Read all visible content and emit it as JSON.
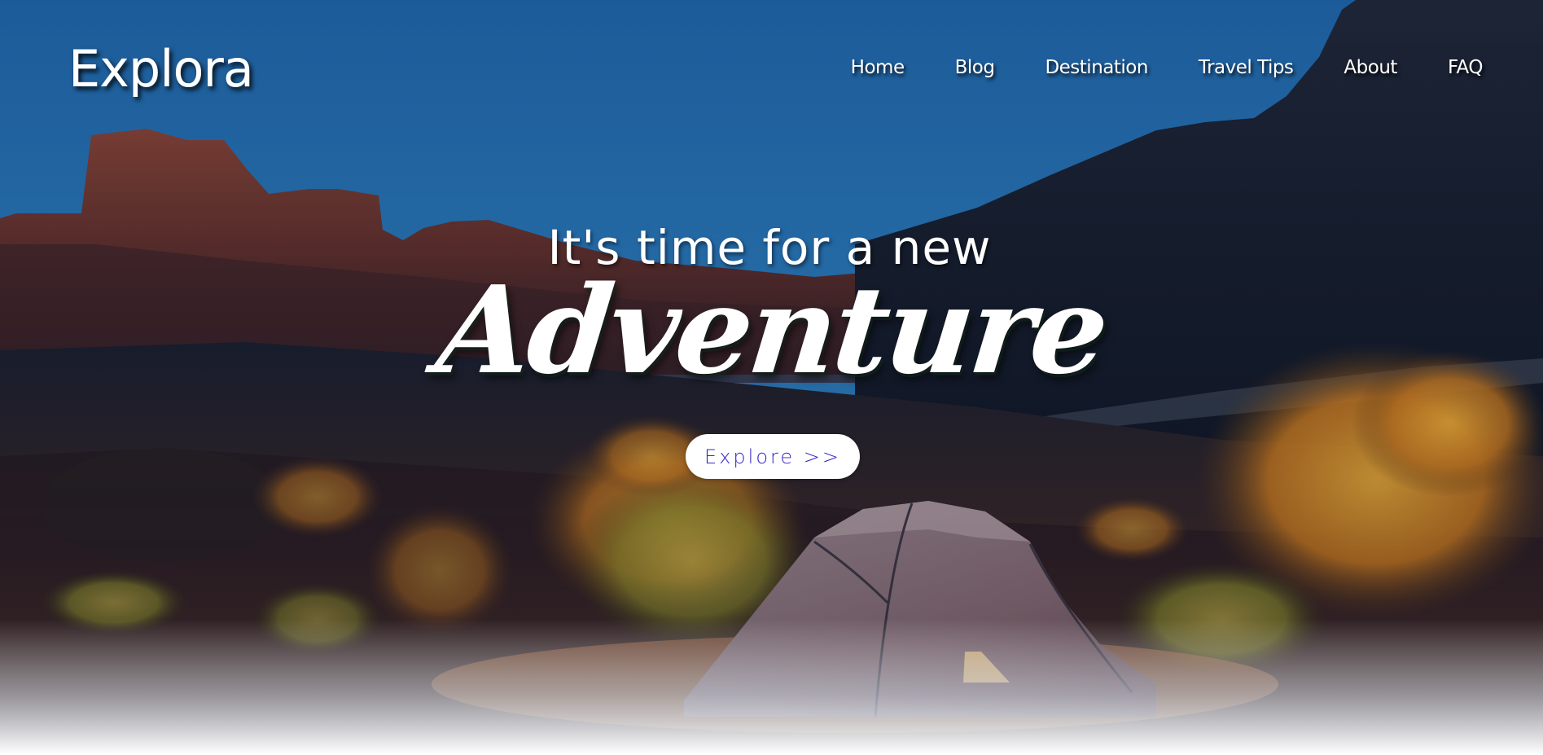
{
  "brand": {
    "logo": "Explora"
  },
  "nav": {
    "items": [
      {
        "label": "Home"
      },
      {
        "label": "Blog"
      },
      {
        "label": "Destination"
      },
      {
        "label": "Travel Tips"
      },
      {
        "label": "About"
      },
      {
        "label": "FAQ"
      }
    ]
  },
  "hero": {
    "subtitle": "It's time for a new",
    "title": "Adventure",
    "cta_label": "Explore >>"
  },
  "colors": {
    "sky": "#1f5f9e",
    "cta_text": "#3526c9",
    "cta_background": "#ffffff",
    "text": "#ffffff"
  }
}
